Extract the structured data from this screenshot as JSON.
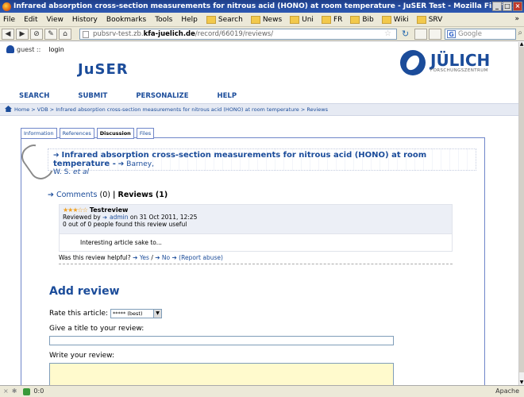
{
  "window": {
    "title": "Infrared absorption cross-section measurements for nitrous acid (HONO) at room temperature - JuSER Test - Mozilla Firefox"
  },
  "menubar": {
    "items": [
      "File",
      "Edit",
      "View",
      "History",
      "Bookmarks",
      "Tools",
      "Help"
    ],
    "bookmarks": [
      "Search",
      "News",
      "Uni",
      "FR",
      "Bib",
      "Wiki",
      "SRV"
    ],
    "more": "»"
  },
  "navbar": {
    "url_prefix": "pubsrv-test.zb.",
    "url_domain": "kfa-juelich.de",
    "url_path": "/record/66019/reviews/",
    "search_placeholder": "Google"
  },
  "site": {
    "user_label": "guest ::",
    "login_label": "login",
    "logo": "JuSER",
    "julich": "JÜLICH",
    "julich_sub": "FORSCHUNGSZENTRUM",
    "nav": [
      "SEARCH",
      "SUBMIT",
      "PERSONALIZE",
      "HELP"
    ],
    "breadcrumb": "Home  >  VDB  >  Infrared absorption cross-section measurements for nitrous acid (HONO) at room temperature  > Reviews"
  },
  "tabs": [
    {
      "label": "Information",
      "active": false
    },
    {
      "label": "References",
      "active": false
    },
    {
      "label": "Discussion",
      "active": true
    },
    {
      "label": "Files",
      "active": false
    }
  ],
  "record": {
    "title": "Infrared absorption cross-section measurements for nitrous acid (HONO) at room temperature -",
    "author": "Barney,",
    "author_cont": "W. S.",
    "etal": "et al"
  },
  "discussion": {
    "comments_label": "Comments",
    "comments_count": "(0)",
    "separator": "|",
    "reviews_label": "Reviews (1)"
  },
  "review": {
    "stars": "★★★☆☆",
    "title": "Testreview",
    "reviewed_by": "Reviewed by",
    "reviewer": "admin",
    "date": "on 31 Oct 2011, 12:25",
    "useful": "0 out of 0 people found this review useful",
    "body": "Interesting article sake to...",
    "helpful_q": "Was this review helpful?",
    "yes": "Yes",
    "no": "No",
    "report": "(Report abuse)"
  },
  "addreview": {
    "heading": "Add review",
    "rate_label": "Rate this article:",
    "rate_value": "***** (best)",
    "give_title_label": "Give a title to your review:",
    "write_label": "Write your review:"
  },
  "statusbar": {
    "text": "0:0",
    "right": "Apache"
  },
  "colors": {
    "brand": "#1b4c9a",
    "titlebar": "#2d59b3",
    "review_bg": "#fffacd"
  }
}
